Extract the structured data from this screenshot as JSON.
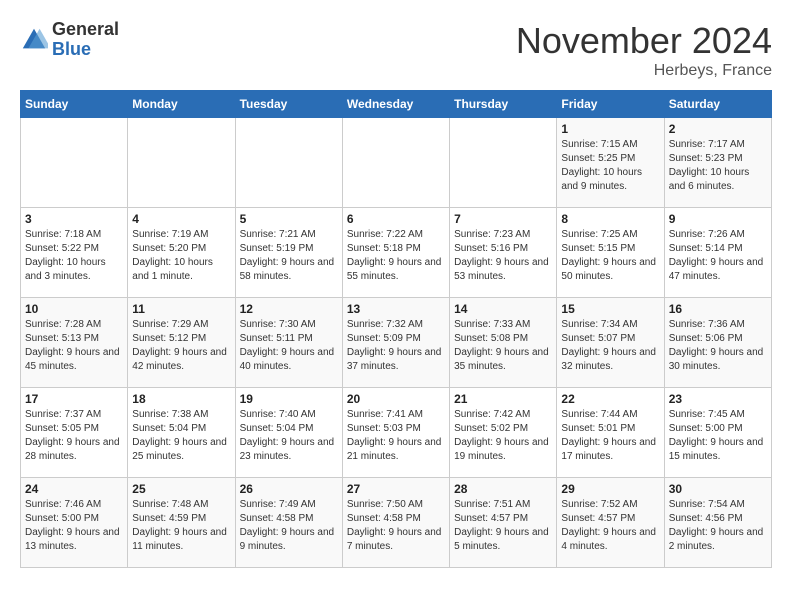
{
  "header": {
    "logo_general": "General",
    "logo_blue": "Blue",
    "month_title": "November 2024",
    "location": "Herbeys, France"
  },
  "days_of_week": [
    "Sunday",
    "Monday",
    "Tuesday",
    "Wednesday",
    "Thursday",
    "Friday",
    "Saturday"
  ],
  "weeks": [
    [
      {
        "day": "",
        "info": ""
      },
      {
        "day": "",
        "info": ""
      },
      {
        "day": "",
        "info": ""
      },
      {
        "day": "",
        "info": ""
      },
      {
        "day": "",
        "info": ""
      },
      {
        "day": "1",
        "info": "Sunrise: 7:15 AM\nSunset: 5:25 PM\nDaylight: 10 hours and 9 minutes."
      },
      {
        "day": "2",
        "info": "Sunrise: 7:17 AM\nSunset: 5:23 PM\nDaylight: 10 hours and 6 minutes."
      }
    ],
    [
      {
        "day": "3",
        "info": "Sunrise: 7:18 AM\nSunset: 5:22 PM\nDaylight: 10 hours and 3 minutes."
      },
      {
        "day": "4",
        "info": "Sunrise: 7:19 AM\nSunset: 5:20 PM\nDaylight: 10 hours and 1 minute."
      },
      {
        "day": "5",
        "info": "Sunrise: 7:21 AM\nSunset: 5:19 PM\nDaylight: 9 hours and 58 minutes."
      },
      {
        "day": "6",
        "info": "Sunrise: 7:22 AM\nSunset: 5:18 PM\nDaylight: 9 hours and 55 minutes."
      },
      {
        "day": "7",
        "info": "Sunrise: 7:23 AM\nSunset: 5:16 PM\nDaylight: 9 hours and 53 minutes."
      },
      {
        "day": "8",
        "info": "Sunrise: 7:25 AM\nSunset: 5:15 PM\nDaylight: 9 hours and 50 minutes."
      },
      {
        "day": "9",
        "info": "Sunrise: 7:26 AM\nSunset: 5:14 PM\nDaylight: 9 hours and 47 minutes."
      }
    ],
    [
      {
        "day": "10",
        "info": "Sunrise: 7:28 AM\nSunset: 5:13 PM\nDaylight: 9 hours and 45 minutes."
      },
      {
        "day": "11",
        "info": "Sunrise: 7:29 AM\nSunset: 5:12 PM\nDaylight: 9 hours and 42 minutes."
      },
      {
        "day": "12",
        "info": "Sunrise: 7:30 AM\nSunset: 5:11 PM\nDaylight: 9 hours and 40 minutes."
      },
      {
        "day": "13",
        "info": "Sunrise: 7:32 AM\nSunset: 5:09 PM\nDaylight: 9 hours and 37 minutes."
      },
      {
        "day": "14",
        "info": "Sunrise: 7:33 AM\nSunset: 5:08 PM\nDaylight: 9 hours and 35 minutes."
      },
      {
        "day": "15",
        "info": "Sunrise: 7:34 AM\nSunset: 5:07 PM\nDaylight: 9 hours and 32 minutes."
      },
      {
        "day": "16",
        "info": "Sunrise: 7:36 AM\nSunset: 5:06 PM\nDaylight: 9 hours and 30 minutes."
      }
    ],
    [
      {
        "day": "17",
        "info": "Sunrise: 7:37 AM\nSunset: 5:05 PM\nDaylight: 9 hours and 28 minutes."
      },
      {
        "day": "18",
        "info": "Sunrise: 7:38 AM\nSunset: 5:04 PM\nDaylight: 9 hours and 25 minutes."
      },
      {
        "day": "19",
        "info": "Sunrise: 7:40 AM\nSunset: 5:04 PM\nDaylight: 9 hours and 23 minutes."
      },
      {
        "day": "20",
        "info": "Sunrise: 7:41 AM\nSunset: 5:03 PM\nDaylight: 9 hours and 21 minutes."
      },
      {
        "day": "21",
        "info": "Sunrise: 7:42 AM\nSunset: 5:02 PM\nDaylight: 9 hours and 19 minutes."
      },
      {
        "day": "22",
        "info": "Sunrise: 7:44 AM\nSunset: 5:01 PM\nDaylight: 9 hours and 17 minutes."
      },
      {
        "day": "23",
        "info": "Sunrise: 7:45 AM\nSunset: 5:00 PM\nDaylight: 9 hours and 15 minutes."
      }
    ],
    [
      {
        "day": "24",
        "info": "Sunrise: 7:46 AM\nSunset: 5:00 PM\nDaylight: 9 hours and 13 minutes."
      },
      {
        "day": "25",
        "info": "Sunrise: 7:48 AM\nSunset: 4:59 PM\nDaylight: 9 hours and 11 minutes."
      },
      {
        "day": "26",
        "info": "Sunrise: 7:49 AM\nSunset: 4:58 PM\nDaylight: 9 hours and 9 minutes."
      },
      {
        "day": "27",
        "info": "Sunrise: 7:50 AM\nSunset: 4:58 PM\nDaylight: 9 hours and 7 minutes."
      },
      {
        "day": "28",
        "info": "Sunrise: 7:51 AM\nSunset: 4:57 PM\nDaylight: 9 hours and 5 minutes."
      },
      {
        "day": "29",
        "info": "Sunrise: 7:52 AM\nSunset: 4:57 PM\nDaylight: 9 hours and 4 minutes."
      },
      {
        "day": "30",
        "info": "Sunrise: 7:54 AM\nSunset: 4:56 PM\nDaylight: 9 hours and 2 minutes."
      }
    ]
  ]
}
